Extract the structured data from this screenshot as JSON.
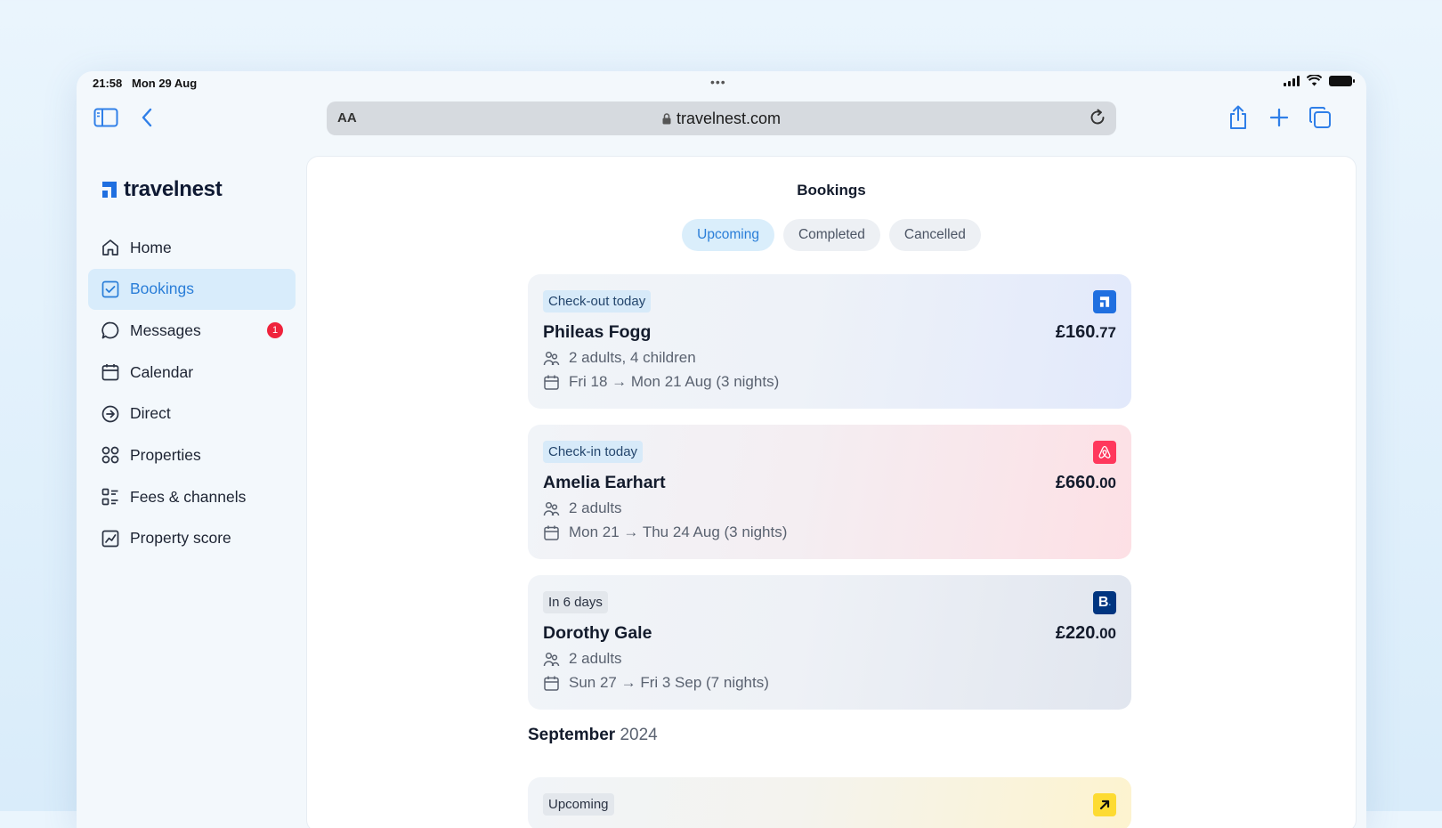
{
  "status": {
    "time": "21:58",
    "date": "Mon 29 Aug",
    "dots": "•••"
  },
  "browser": {
    "text_size": "AA",
    "url": "travelnest.com"
  },
  "brand": {
    "name": "travelnest",
    "accent": "#2a7ed8"
  },
  "nav": [
    {
      "label": "Home",
      "icon": "home-icon"
    },
    {
      "label": "Bookings",
      "icon": "check-square-icon",
      "active": true
    },
    {
      "label": "Messages",
      "icon": "chat-bubble-icon",
      "badge": "1"
    },
    {
      "label": "Calendar",
      "icon": "calendar-icon"
    },
    {
      "label": "Direct",
      "icon": "arrow-circle-icon"
    },
    {
      "label": "Properties",
      "icon": "grid-icon"
    },
    {
      "label": "Fees & channels",
      "icon": "list-icon"
    },
    {
      "label": "Property score",
      "icon": "chart-icon"
    }
  ],
  "page": {
    "title": "Bookings"
  },
  "tabs": [
    {
      "label": "Upcoming",
      "active": true
    },
    {
      "label": "Completed"
    },
    {
      "label": "Cancelled"
    }
  ],
  "bookings": [
    {
      "tag": "Check-out today",
      "guest": "Phileas Fogg",
      "price_main": "£160",
      "price_cents": ".77",
      "guests": "2 adults, 4 children",
      "dates": "Fri 18 → Mon 21 Aug (3 nights)",
      "channel": "travelnest",
      "channel_color": "#1f6fe0"
    },
    {
      "tag": "Check-in today",
      "guest": "Amelia Earhart",
      "price_main": "£660",
      "price_cents": ".00",
      "guests": "2 adults",
      "dates": "Mon 21 → Thu 24 Aug (3 nights)",
      "channel": "airbnb",
      "channel_color": "#ff385c"
    },
    {
      "tag": "In 6 days",
      "guest": "Dorothy Gale",
      "price_main": "£220",
      "price_cents": ".00",
      "guests": "2 adults",
      "dates": "Sun 27 → Fri 3 Sep (7 nights)",
      "channel": "booking.com",
      "channel_color": "#003580"
    }
  ],
  "section": {
    "month": "September",
    "year": "2024"
  },
  "next_booking": {
    "tag": "Upcoming",
    "channel": "expedia",
    "channel_color": "#fddb32"
  }
}
